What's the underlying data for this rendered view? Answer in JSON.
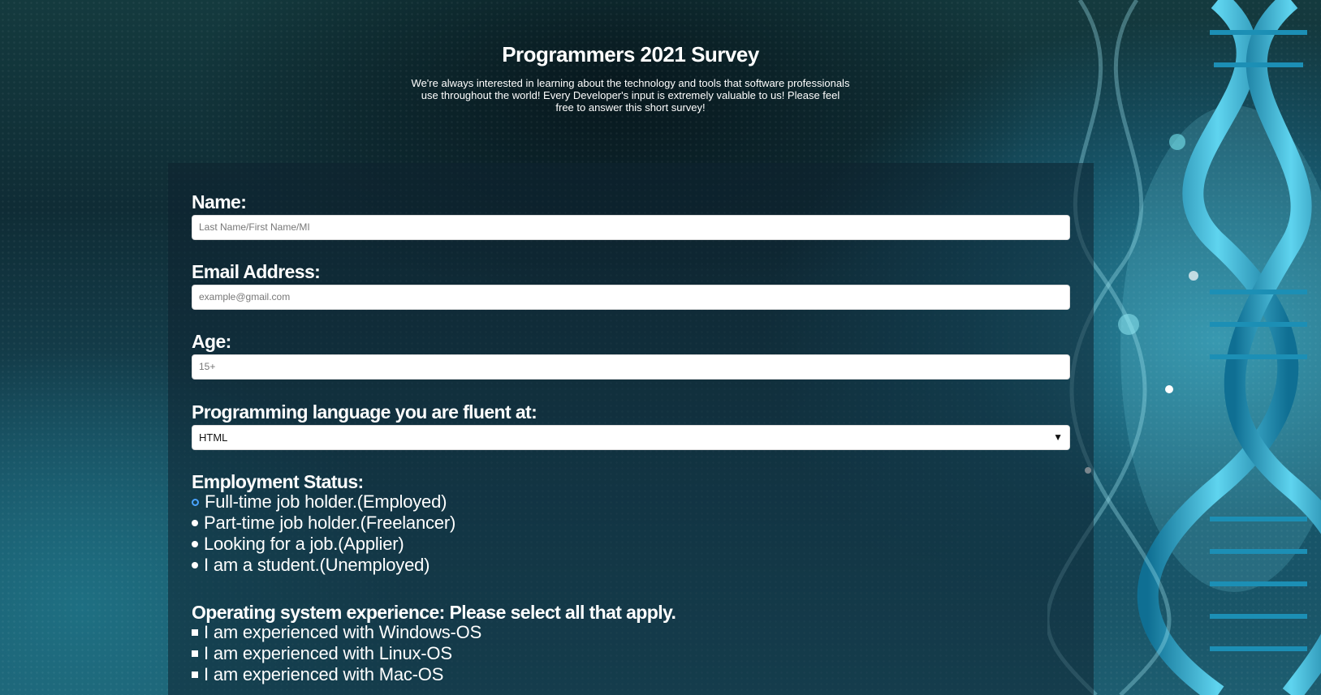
{
  "header": {
    "title": "Programmers 2021 Survey",
    "description": "We're always interested in learning about the technology and tools that software professionals use throughout the world! Every Developer's input is extremely valuable to us! Please feel free to answer this short survey!"
  },
  "form": {
    "name": {
      "label": "Name:",
      "placeholder": "Last Name/First Name/MI"
    },
    "email": {
      "label": "Email Address:",
      "placeholder": "example@gmail.com"
    },
    "age": {
      "label": "Age:",
      "placeholder": "15+"
    },
    "language": {
      "label": "Programming language you are fluent at:",
      "selected": "HTML"
    },
    "employment": {
      "label": "Employment Status:",
      "options": [
        "Full-time job holder.(Employed)",
        "Part-time job holder.(Freelancer)",
        "Looking for a job.(Applier)",
        "I am a student.(Unemployed)"
      ]
    },
    "os": {
      "label": "Operating system experience: Please select all that apply.",
      "options": [
        "I am experienced with Windows-OS",
        "I am experienced with Linux-OS",
        "I am experienced with Mac-OS"
      ]
    }
  },
  "colors": {
    "background": "#163f4c",
    "panel": "#0e2230",
    "radio_focus": "#4aa3ff",
    "dna": "#2fb5d8"
  }
}
